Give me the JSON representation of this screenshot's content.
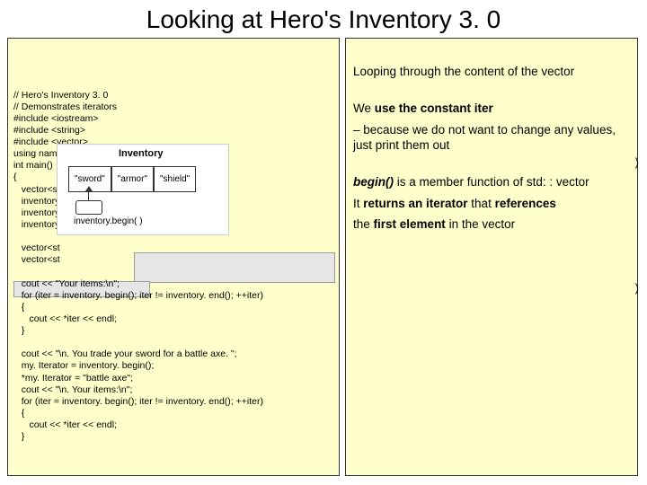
{
  "title": "Looking at Hero's Inventory 3. 0",
  "code": {
    "l1": "// Hero's Inventory 3. 0",
    "l2": "// Demonstrates iterators",
    "l3": "#include <iostream>",
    "l4": "#include <string>",
    "l5": "#include <vector>",
    "l6": "using namespace std;",
    "l7": "int main()",
    "l8": "{",
    "l9": "   vector<st",
    "l10": "   inventory",
    "l11": "   inventory",
    "l12": "   inventory",
    "l13": "",
    "l14": "   vector<st",
    "l15": "   vector<st",
    "l16": "",
    "l17": "   cout << \"Your items:\\n\";",
    "l18": "   for (iter = inventory. begin(); iter != inventory. end(); ++iter)",
    "l19": "   {",
    "l20": "      cout << *iter << endl;",
    "l21": "   }",
    "l22": "",
    "l23": "   cout << \"\\n. You trade your sword for a battle axe. \";",
    "l24": "   my. Iterator = inventory. begin();",
    "l25": "   *my. Iterator = \"battle axe\";",
    "l26": "   cout << \"\\n. Your items:\\n\";",
    "l27": "   for (iter = inventory. begin(); iter != inventory. end(); ++iter)",
    "l28": "   {",
    "l29": "      cout << *iter << endl;",
    "l30": "   }"
  },
  "diagram": {
    "title": "Inventory",
    "cell1": "\"sword\"",
    "cell2": "\"armor\"",
    "cell3": "\"shield\"",
    "caption": "inventory.begin( )"
  },
  "annot": {
    "p1": "Looping through the content of the vector",
    "p2a": "We ",
    "p2b": "use the constant iter",
    "p3": "– because we do not want to change any values, just print them out",
    "p4a": "begin()",
    "p4b": " is a member function of std: : vector",
    "p5a": "It ",
    "p5b": "returns an iterator",
    "p5c": " that ",
    "p5d": "references",
    "p6a": "the ",
    "p6b": "first element",
    "p6c": " in the vector"
  },
  "stray": ")"
}
